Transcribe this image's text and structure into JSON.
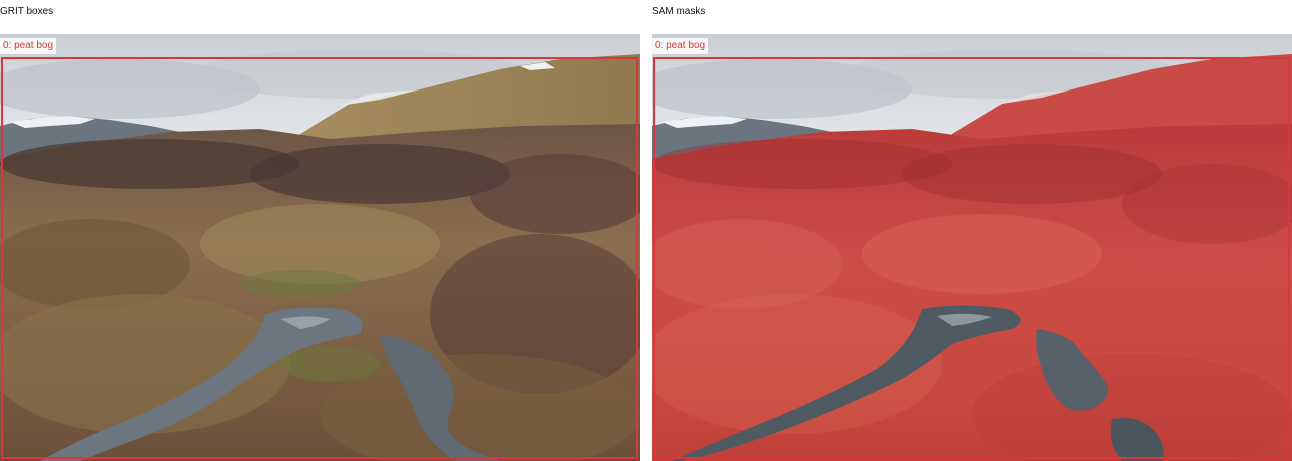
{
  "panels": [
    {
      "title": "GRIT boxes",
      "box_label": "0: peat bog"
    },
    {
      "title": "SAM masks",
      "box_label": "0: peat bog"
    }
  ],
  "colors": {
    "box_border": "#d9363e",
    "box_label_text": "#d9363e",
    "mask_fill": "#d23a3a"
  }
}
